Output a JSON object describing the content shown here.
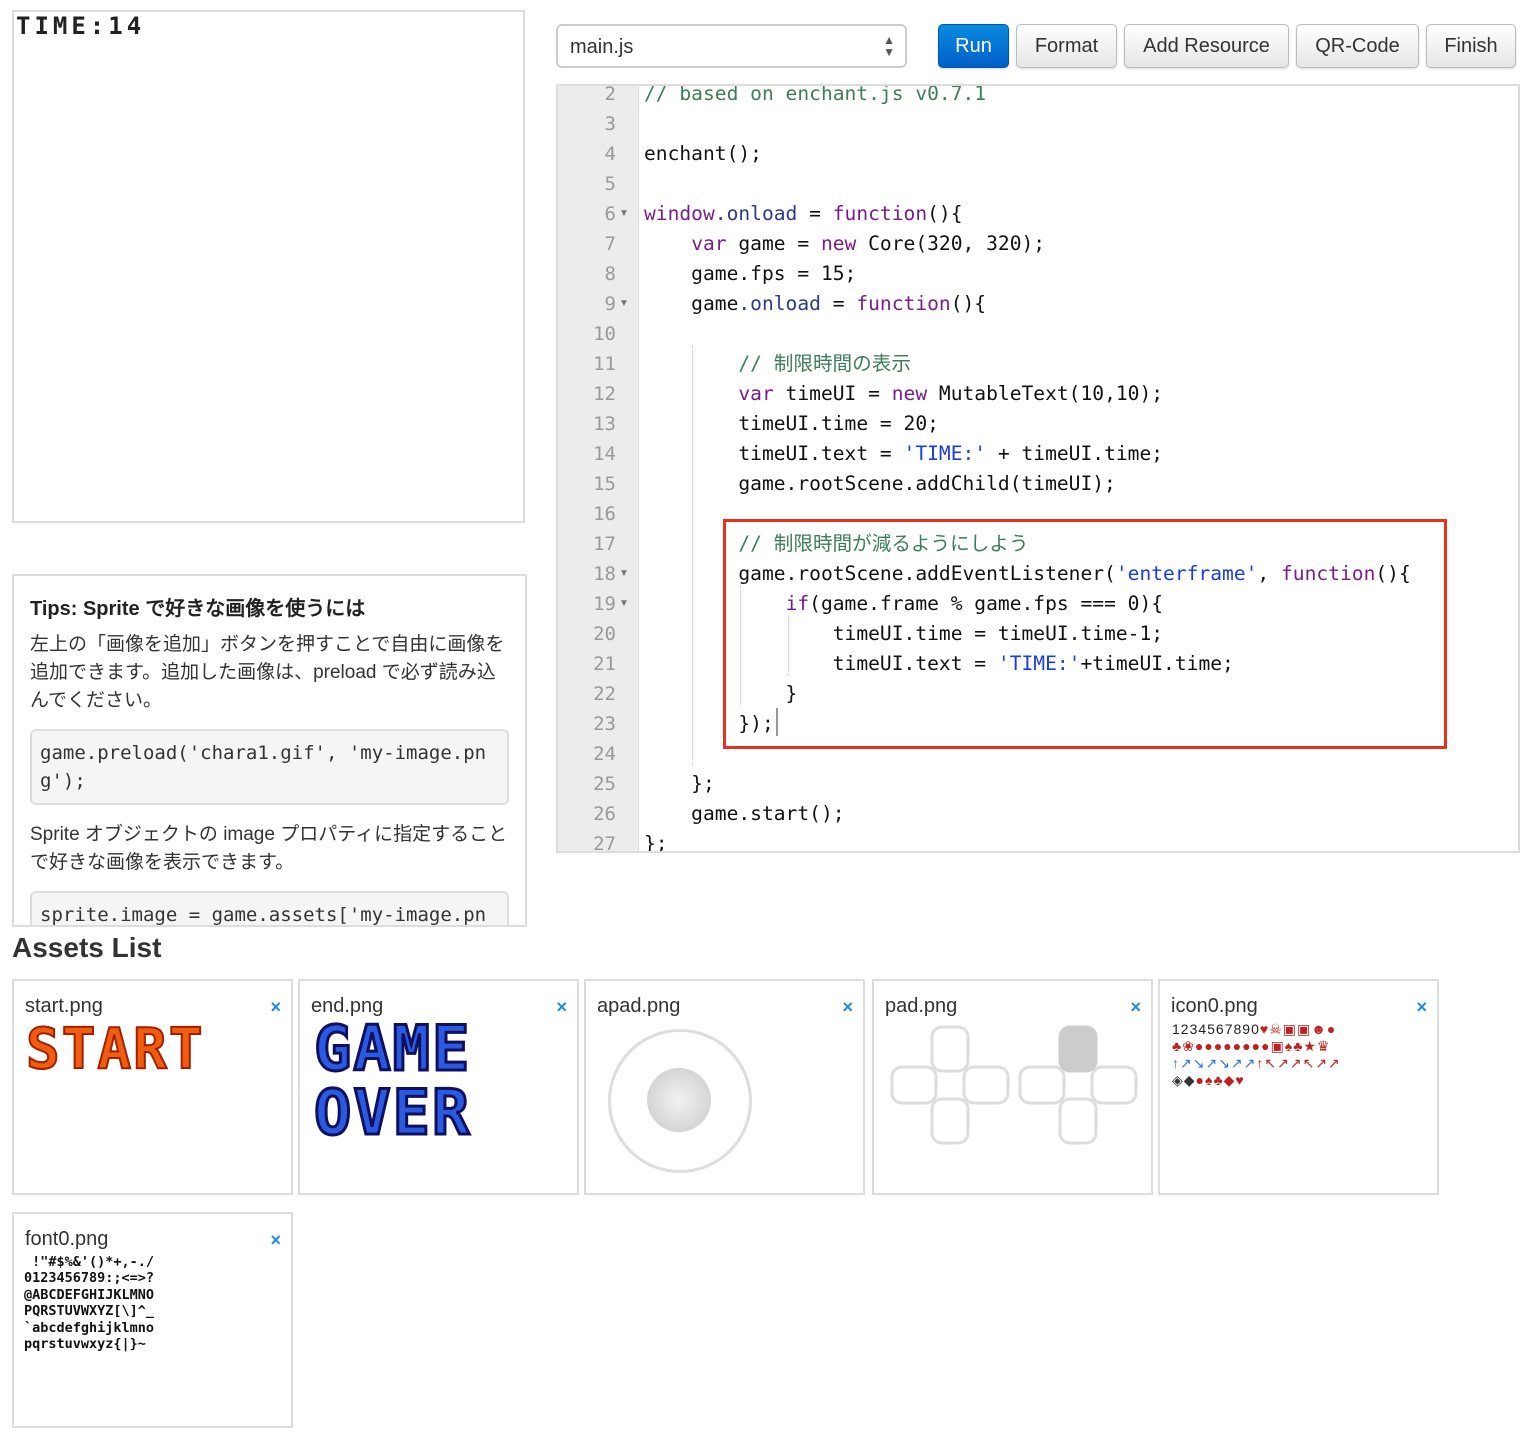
{
  "game_screen": {
    "time_label": "TIME:14"
  },
  "tips": {
    "title": "Tips: Sprite で好きな画像を使うには",
    "para1": "左上の「画像を追加」ボタンを押すことで自由に画像を追加できます。追加した画像は、preload で必ず読み込んでください。",
    "code1": "game.preload('chara1.gif', 'my-image.png');",
    "para2": "Sprite オブジェクトの image プロパティに指定することで好きな画像を表示できます。",
    "code2": "sprite.image = game.assets['my-image.png'];"
  },
  "toolbar": {
    "file_select": "main.js",
    "run": "Run",
    "format": "Format",
    "add_resource": "Add Resource",
    "qr_code": "QR-Code",
    "finish": "Finish",
    "accent": "#0a74d6"
  },
  "editor": {
    "colors": {
      "comment": "#3c7d5a",
      "keyword": "#7a1c8c",
      "property": "#2a3a8a",
      "string": "#1a3ce0",
      "plain": "#111111"
    },
    "lines": [
      {
        "n": "2",
        "tokens": [
          [
            "// based on enchant.js v0.7.1",
            "comment"
          ]
        ]
      },
      {
        "n": "3",
        "tokens": []
      },
      {
        "n": "4",
        "tokens": [
          [
            "enchant();",
            "plain"
          ]
        ]
      },
      {
        "n": "5",
        "tokens": []
      },
      {
        "n": "6",
        "fold": true,
        "tokens": [
          [
            "window",
            "keyword"
          ],
          [
            ".onload",
            "property"
          ],
          [
            " = ",
            "plain"
          ],
          [
            "function",
            "keyword"
          ],
          [
            "(){",
            "plain"
          ]
        ]
      },
      {
        "n": "7",
        "tokens": [
          [
            "    ",
            "plain"
          ],
          [
            "var",
            "keyword"
          ],
          [
            " game = ",
            "plain"
          ],
          [
            "new",
            "keyword"
          ],
          [
            " Core(320, 320);",
            "plain"
          ]
        ]
      },
      {
        "n": "8",
        "tokens": [
          [
            "    game.fps = 15;",
            "plain"
          ]
        ]
      },
      {
        "n": "9",
        "fold": true,
        "tokens": [
          [
            "    game",
            "plain"
          ],
          [
            ".onload",
            "property"
          ],
          [
            " = ",
            "plain"
          ],
          [
            "function",
            "keyword"
          ],
          [
            "(){",
            "plain"
          ]
        ]
      },
      {
        "n": "10",
        "tokens": []
      },
      {
        "n": "11",
        "tokens": [
          [
            "        // 制限時間の表示",
            "comment"
          ]
        ]
      },
      {
        "n": "12",
        "tokens": [
          [
            "        ",
            "plain"
          ],
          [
            "var",
            "keyword"
          ],
          [
            " timeUI = ",
            "plain"
          ],
          [
            "new",
            "keyword"
          ],
          [
            " MutableText(10,10);",
            "plain"
          ]
        ]
      },
      {
        "n": "13",
        "tokens": [
          [
            "        timeUI.time = 20;",
            "plain"
          ]
        ]
      },
      {
        "n": "14",
        "tokens": [
          [
            "        timeUI.text = ",
            "plain"
          ],
          [
            "'TIME:'",
            "string"
          ],
          [
            " + timeUI.time;",
            "plain"
          ]
        ]
      },
      {
        "n": "15",
        "tokens": [
          [
            "        game.rootScene.addChild(timeUI);",
            "plain"
          ]
        ]
      },
      {
        "n": "16",
        "tokens": []
      },
      {
        "n": "17",
        "tokens": [
          [
            "        // 制限時間が減るようにしよう",
            "comment"
          ]
        ]
      },
      {
        "n": "18",
        "fold": true,
        "tokens": [
          [
            "        game.rootScene.addEventListener(",
            "plain"
          ],
          [
            "'enterframe'",
            "string"
          ],
          [
            ", ",
            "plain"
          ],
          [
            "function",
            "keyword"
          ],
          [
            "(){",
            "plain"
          ]
        ]
      },
      {
        "n": "19",
        "fold": true,
        "tokens": [
          [
            "            ",
            "plain"
          ],
          [
            "if",
            "keyword"
          ],
          [
            "(game.frame % game.fps === 0){",
            "plain"
          ]
        ]
      },
      {
        "n": "20",
        "tokens": [
          [
            "                timeUI.time = timeUI.time-1;",
            "plain"
          ]
        ]
      },
      {
        "n": "21",
        "tokens": [
          [
            "                timeUI.text = ",
            "plain"
          ],
          [
            "'TIME:'",
            "string"
          ],
          [
            "+timeUI.time;",
            "plain"
          ]
        ]
      },
      {
        "n": "22",
        "tokens": [
          [
            "            }",
            "plain"
          ]
        ]
      },
      {
        "n": "23",
        "tokens": [
          [
            "        });",
            "plain"
          ]
        ]
      },
      {
        "n": "24",
        "tokens": []
      },
      {
        "n": "25",
        "tokens": [
          [
            "    };",
            "plain"
          ]
        ]
      },
      {
        "n": "26",
        "tokens": [
          [
            "    game.start();",
            "plain"
          ]
        ]
      },
      {
        "n": "27",
        "tokens": [
          [
            "};",
            "plain"
          ]
        ]
      }
    ],
    "highlight_color": "#e8321c"
  },
  "assets": {
    "title": "Assets List",
    "remove_icon": "×",
    "items": [
      {
        "name": "start.png",
        "logo_text": "START"
      },
      {
        "name": "end.png",
        "logo_text": "GAME OVER"
      },
      {
        "name": "apad.png"
      },
      {
        "name": "pad.png"
      },
      {
        "name": "icon0.png"
      },
      {
        "name": "font0.png",
        "glyph_rows": [
          " !\"#$%&'()*+,-./",
          "0123456789:;<=>?",
          "@ABCDEFGHIJKLMNO",
          "PQRSTUVWXYZ[\\]^_",
          "`abcdefghijklmno",
          "pqrstuvwxyz{|}~"
        ]
      }
    ]
  }
}
